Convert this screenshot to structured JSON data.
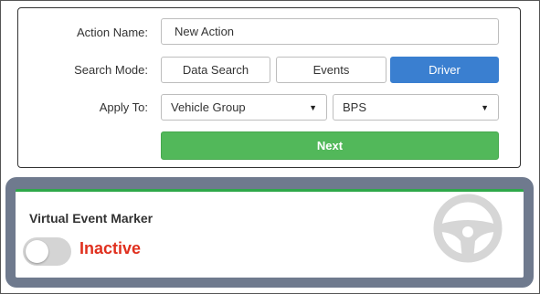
{
  "form": {
    "action_name_label": "Action Name:",
    "action_name_value": "New Action",
    "search_mode_label": "Search Mode:",
    "search_modes": [
      "Data Search",
      "Events",
      "Driver"
    ],
    "selected_mode": "Driver",
    "apply_to_label": "Apply To:",
    "apply_to_type": "Vehicle Group",
    "apply_to_value": "BPS",
    "next_label": "Next"
  },
  "marker": {
    "title": "Virtual Event Marker",
    "status": "Inactive",
    "toggle_on": false,
    "icon": "steering-wheel-icon"
  },
  "colors": {
    "accent_blue": "#3a7fd0",
    "next_green": "#52b85a",
    "panel_border": "#6f7a8e",
    "inactive_red": "#e0301e"
  }
}
